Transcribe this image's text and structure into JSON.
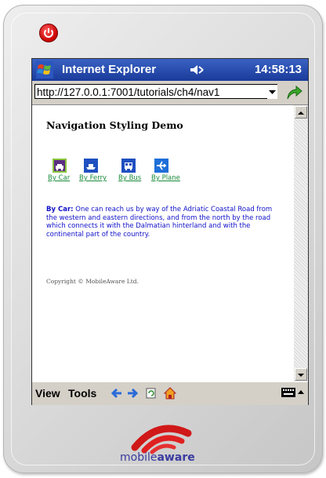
{
  "titlebar": {
    "app_title": "Internet Explorer",
    "clock": "14:58:13"
  },
  "address": {
    "url": "http://127.0.0.1:7001/tutorials/ch4/nav1"
  },
  "page": {
    "heading": "Navigation Styling Demo",
    "nav_links": [
      {
        "label": "By Car",
        "icon": "car-icon",
        "color": "#5a2d82"
      },
      {
        "label": "By Ferry",
        "icon": "ferry-icon",
        "color": "#1f4fc0"
      },
      {
        "label": "By Bus",
        "icon": "bus-icon",
        "color": "#1f4fc0"
      },
      {
        "label": "By Plane",
        "icon": "plane-icon",
        "color": "#1f6fd8"
      }
    ],
    "description_lead": "By Car:",
    "description_body": " One can reach us by way of the Adriatic Coastal Road from the western and eastern directions, and from the north by the road which connects it with the Dalmatian hinterland and with the continental part of the country.",
    "copyright": "Copyright © MobileAware Ltd."
  },
  "taskbar": {
    "view_label": "View",
    "tools_label": "Tools"
  },
  "branding": {
    "logo_light": "mobile",
    "logo_bold": "aware"
  },
  "colors": {
    "titlebar": "#1a3b9a",
    "link": "#1a8a3a",
    "description": "#1010c8",
    "logo_red": "#d01818"
  }
}
